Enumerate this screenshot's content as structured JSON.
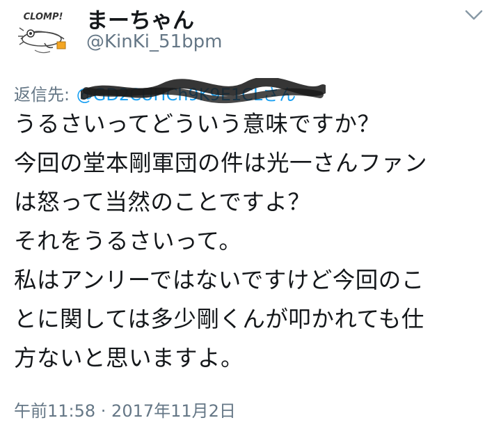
{
  "author": {
    "display_name": "まーちゃん",
    "handle": "@KinKi_51bpm",
    "avatar_text": "CLOMP!"
  },
  "menu": {
    "icon": "chevron-down-icon"
  },
  "reply": {
    "label": "返信先:",
    "target": "@GD2CUHCh9K9E1CLさん"
  },
  "tweet": {
    "lines": [
      "うるさいってどういう意味ですか？",
      "今回の堂本剛軍団の件は光一さんファン",
      "は怒って当然のことですよ？",
      "それをうるさいって。",
      "私はアンリーではないですけど今回のこ",
      "とに関しては多少剛くんが叩かれても仕",
      "方ないと思いますよ。"
    ]
  },
  "timestamp": "午前11:58 · 2017年11月2日",
  "colors": {
    "text_primary": "#14171a",
    "text_secondary": "#657786",
    "link": "#1da1f2",
    "redaction": "#1a1a1a"
  }
}
